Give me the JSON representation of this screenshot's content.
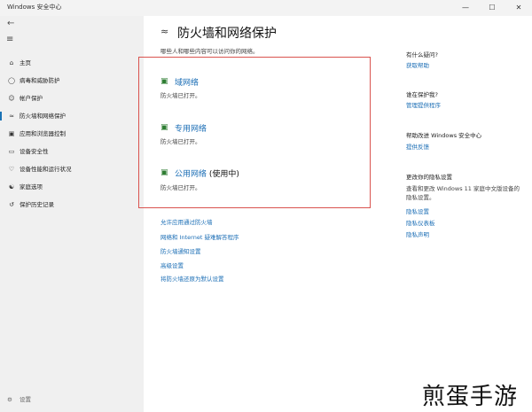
{
  "window": {
    "title": "Windows 安全中心",
    "minimize": "—",
    "maximize": "☐",
    "close": "✕"
  },
  "sidebar": {
    "back_icon": "arrow-left-icon",
    "menu_icon": "hamburger-icon",
    "items": [
      {
        "label": "主页",
        "icon": "home-icon"
      },
      {
        "label": "病毒和威胁防护",
        "icon": "shield-icon"
      },
      {
        "label": "帐户保护",
        "icon": "person-icon"
      },
      {
        "label": "防火墙和网络保护",
        "icon": "wifi-icon"
      },
      {
        "label": "应用和浏览器控制",
        "icon": "app-window-icon"
      },
      {
        "label": "设备安全性",
        "icon": "laptop-icon"
      },
      {
        "label": "设备性能和运行状况",
        "icon": "heart-icon"
      },
      {
        "label": "家庭选项",
        "icon": "family-icon"
      },
      {
        "label": "保护历史记录",
        "icon": "history-icon"
      }
    ],
    "active_index": 3,
    "settings_label": "设置"
  },
  "main": {
    "title": "防火墙和网络保护",
    "subtitle": "哪些人和哪些内容可以访问你的网络。",
    "networks": [
      {
        "name": "域网络",
        "status": "防火墙已打开。",
        "active_tag": ""
      },
      {
        "name": "专用网络",
        "status": "防火墙已打开。",
        "active_tag": ""
      },
      {
        "name": "公用网络",
        "status": "防火墙已打开。",
        "active_tag": "(使用中)"
      }
    ],
    "links": [
      "允许应用通过防火墙",
      "网络和 Internet 疑难解答程序",
      "防火墙通知设置",
      "高级设置",
      "将防火墙还原为默认设置"
    ]
  },
  "right_panel": {
    "sections": [
      {
        "title": "有什么疑问?",
        "links": [
          "获取帮助"
        ]
      },
      {
        "title": "谁在保护我?",
        "links": [
          "管理提供程序"
        ]
      },
      {
        "title": "帮助改进 Windows 安全中心",
        "links": [
          "提供反馈"
        ]
      },
      {
        "title": "更改你的隐私设置",
        "text": "查看和更改 Windows 11 家庭中文版设备的隐私设置。",
        "links": [
          "隐私设置",
          "隐私仪表板",
          "隐私声明"
        ]
      }
    ]
  },
  "watermark": "煎蛋手游",
  "colors": {
    "accent": "#1a6db5",
    "highlight_box": "#d9534f",
    "firewall_ok": "#2e7d32"
  }
}
